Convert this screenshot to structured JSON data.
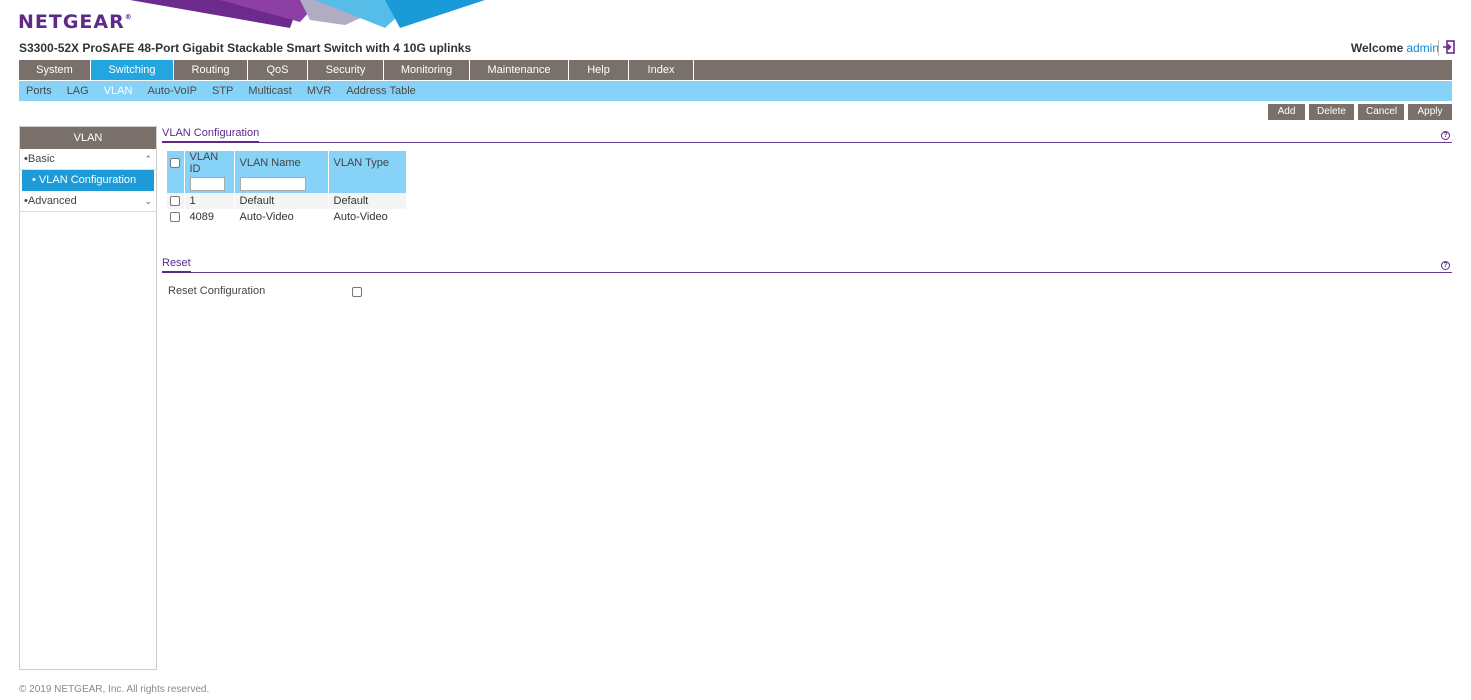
{
  "brand": {
    "logo": "NETGEAR",
    "registered": "®",
    "purple": "#5d2a8a",
    "blue": "#23a6e0"
  },
  "product_title": "S3300-52X ProSAFE 48-Port Gigabit Stackable Smart Switch with 4 10G uplinks",
  "welcome": {
    "label": "Welcome",
    "user": "admin",
    "logout_icon": "logout-icon"
  },
  "main_nav": [
    {
      "label": "System"
    },
    {
      "label": "Switching",
      "active": true
    },
    {
      "label": "Routing"
    },
    {
      "label": "QoS"
    },
    {
      "label": "Security"
    },
    {
      "label": "Monitoring"
    },
    {
      "label": "Maintenance"
    },
    {
      "label": "Help"
    },
    {
      "label": "Index"
    }
  ],
  "sub_nav": [
    {
      "label": "Ports"
    },
    {
      "label": "LAG"
    },
    {
      "label": "VLAN",
      "active": true
    },
    {
      "label": "Auto-VoIP"
    },
    {
      "label": "STP"
    },
    {
      "label": "Multicast"
    },
    {
      "label": "MVR"
    },
    {
      "label": "Address Table"
    }
  ],
  "actions": {
    "add": "Add",
    "delete": "Delete",
    "cancel": "Cancel",
    "apply": "Apply"
  },
  "sidebar": {
    "title": "VLAN",
    "basic": "Basic",
    "basic_item": "VLAN Configuration",
    "advanced": "Advanced"
  },
  "vlan_config": {
    "title": "VLAN Configuration",
    "help": "?",
    "columns": [
      "VLAN ID",
      "VLAN Name",
      "VLAN Type"
    ],
    "rows": [
      {
        "id": "1",
        "name": "Default",
        "type": "Default"
      },
      {
        "id": "4089",
        "name": "Auto-Video",
        "type": "Auto-Video"
      }
    ]
  },
  "reset": {
    "title": "Reset",
    "help": "?",
    "label": "Reset Configuration"
  },
  "footer": "© 2019 NETGEAR, Inc. All rights reserved."
}
